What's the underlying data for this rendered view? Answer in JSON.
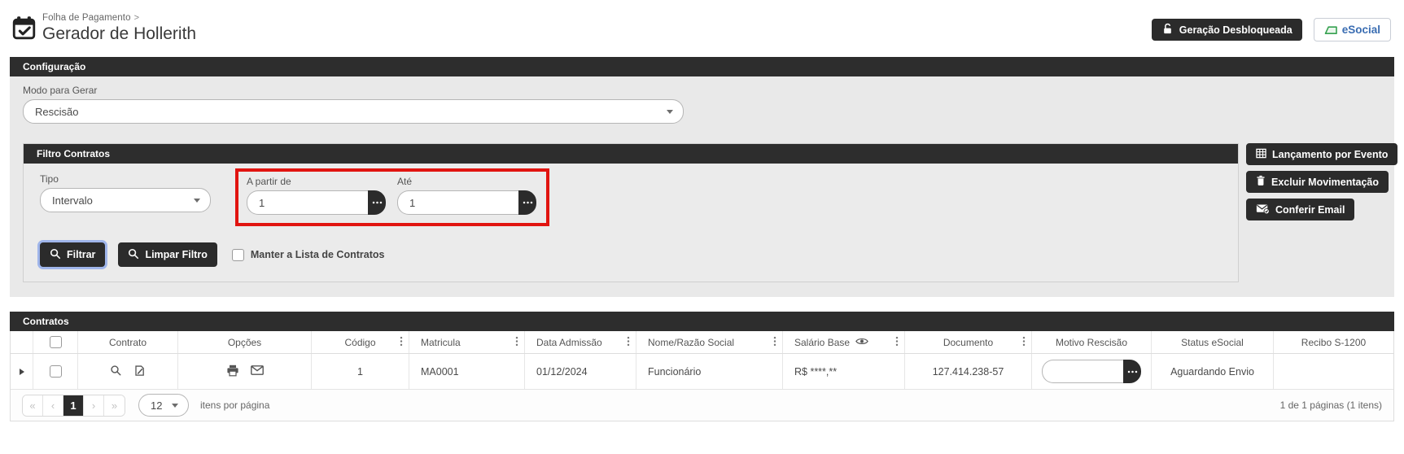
{
  "header": {
    "breadcrumb": "Folha de Pagamento",
    "breadcrumb_sep": ">",
    "title": "Gerador de Hollerith",
    "generation_button": "Geração Desbloqueada",
    "esocial_button": "eSocial"
  },
  "config": {
    "section_title": "Configuração",
    "mode_label": "Modo para Gerar",
    "mode_value": "Rescisão"
  },
  "filter": {
    "section_title": "Filtro Contratos",
    "tipo_label": "Tipo",
    "tipo_value": "Intervalo",
    "from_label": "A partir de",
    "from_value": "1",
    "to_label": "Até",
    "to_value": "1",
    "filter_button": "Filtrar",
    "clear_button": "Limpar Filtro",
    "keep_list_label": "Manter a Lista de Contratos",
    "side_buttons": [
      "Lançamento por Evento",
      "Excluir Movimentação",
      "Conferir Email"
    ]
  },
  "contracts": {
    "section_title": "Contratos",
    "columns": [
      "Contrato",
      "Opções",
      "Código",
      "Matricula",
      "Data Admissão",
      "Nome/Razão Social",
      "Salário Base",
      "Documento",
      "Motivo Rescisão",
      "Status eSocial",
      "Recibo S-1200"
    ],
    "row": {
      "codigo": "1",
      "matricula": "MA0001",
      "data_admissao": "01/12/2024",
      "nome": "Funcionário",
      "salario": "R$ ****,**",
      "documento": "127.414.238-57",
      "motivo_rescisao": "",
      "status_esocial": "Aguardando Envio",
      "recibo": ""
    }
  },
  "pagination": {
    "first": "«",
    "prev": "‹",
    "page": "1",
    "next": "›",
    "last": "»",
    "page_size": "12",
    "items_per_page_label": "itens por página",
    "summary": "1 de 1 páginas (1 itens)"
  },
  "colors": {
    "dark_bar": "#2d2d2d",
    "panel_gray": "#e9e9e9",
    "annotation_red": "#e11410",
    "esocial_blue": "#3a6db2",
    "esocial_green": "#35a14f"
  }
}
